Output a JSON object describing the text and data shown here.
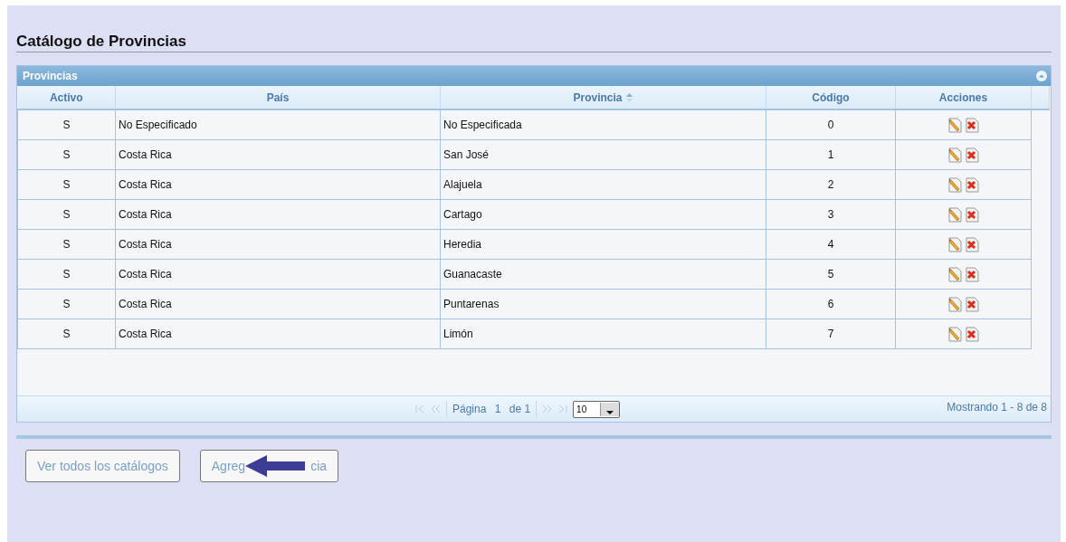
{
  "page_title": "Catálogo de Provincias",
  "grid": {
    "caption": "Provincias",
    "columns": [
      {
        "label": "Activo",
        "sorted": false
      },
      {
        "label": "País",
        "sorted": false
      },
      {
        "label": "Provincia",
        "sorted": true
      },
      {
        "label": "Código",
        "sorted": false
      },
      {
        "label": "Acciones",
        "sorted": false
      }
    ],
    "rows": [
      {
        "activo": "S",
        "pais": "No Especificado",
        "provincia": "No Especificada",
        "codigo": "0"
      },
      {
        "activo": "S",
        "pais": "Costa Rica",
        "provincia": "San José",
        "codigo": "1"
      },
      {
        "activo": "S",
        "pais": "Costa Rica",
        "provincia": "Alajuela",
        "codigo": "2"
      },
      {
        "activo": "S",
        "pais": "Costa Rica",
        "provincia": "Cartago",
        "codigo": "3"
      },
      {
        "activo": "S",
        "pais": "Costa Rica",
        "provincia": "Heredia",
        "codigo": "4"
      },
      {
        "activo": "S",
        "pais": "Costa Rica",
        "provincia": "Guanacaste",
        "codigo": "5"
      },
      {
        "activo": "S",
        "pais": "Costa Rica",
        "provincia": "Puntarenas",
        "codigo": "6"
      },
      {
        "activo": "S",
        "pais": "Costa Rica",
        "provincia": "Limón",
        "codigo": "7"
      }
    ],
    "pager": {
      "page_label": "Página",
      "page": "1",
      "of_label": "de 1",
      "page_size": "10",
      "summary": "Mostrando 1 - 8 de 8"
    }
  },
  "buttons": [
    {
      "label_start": "Ver todos los catálogos"
    },
    {
      "label_start": "Agreg",
      "label_end": "cia",
      "covered": true
    }
  ]
}
